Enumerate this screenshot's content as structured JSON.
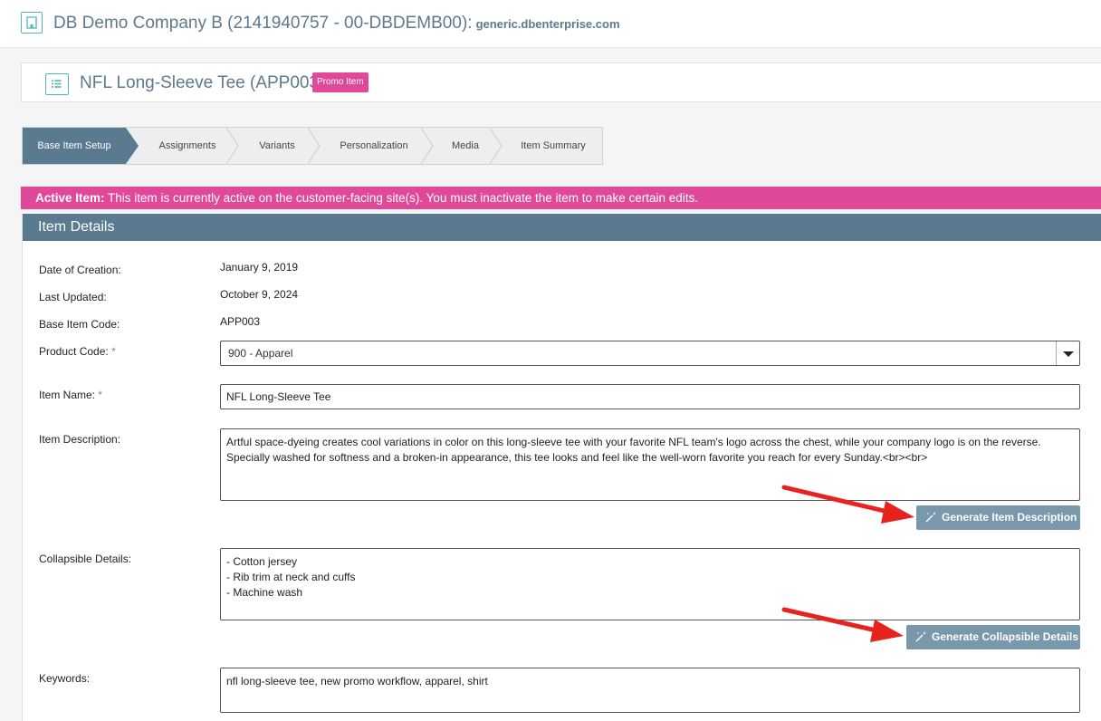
{
  "header": {
    "company_title": "DB Demo Company B (2141940757 - 00-DBDEMB00):",
    "company_domain": "generic.dbenterprise.com"
  },
  "item": {
    "title": "NFL Long-Sleeve Tee (APP003)",
    "badge": "Promo Item"
  },
  "wizard": {
    "steps": [
      "Base Item Setup",
      "Assignments",
      "Variants",
      "Personalization",
      "Media",
      "Item Summary"
    ]
  },
  "alert": {
    "label": "Active Item:",
    "text": "This item is currently active on the customer-facing site(s). You must inactivate the item to make certain edits."
  },
  "panel": {
    "title": "Item Details"
  },
  "fields": {
    "date_of_creation": {
      "label": "Date of Creation:",
      "value": "January 9, 2019"
    },
    "last_updated": {
      "label": "Last Updated:",
      "value": "October 9, 2024"
    },
    "base_item_code": {
      "label": "Base Item Code:",
      "value": "APP003"
    },
    "product_code": {
      "label": "Product Code:",
      "required": "*",
      "value": "900 - Apparel"
    },
    "item_name": {
      "label": "Item Name:",
      "required": "*",
      "value": "NFL Long-Sleeve Tee"
    },
    "item_description": {
      "label": "Item Description:",
      "value": "Artful space-dyeing creates cool variations in color on this long-sleeve tee with your favorite NFL team's logo across the chest, while your company logo is on the reverse. Specially washed for softness and a broken-in appearance, this tee looks and feel like the well-worn favorite you reach for every Sunday.<br><br>",
      "button": "Generate Item Description"
    },
    "collapsible_details": {
      "label": "Collapsible Details:",
      "value": "- Cotton jersey\n- Rib trim at neck and cuffs\n- Machine wash",
      "button": "Generate Collapsible Details"
    },
    "keywords": {
      "label": "Keywords:",
      "value": "nfl long-sleeve tee, new promo workflow, apparel, shirt"
    }
  },
  "colors": {
    "accent": "#5a7a90",
    "badge": "#e0489a",
    "button": "#7998ab",
    "annotation_arrow": "#e8231f"
  }
}
